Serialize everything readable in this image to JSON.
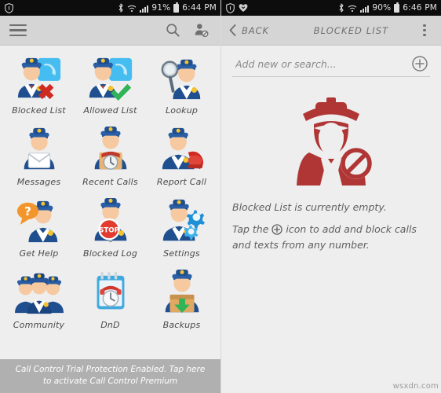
{
  "colors": {
    "statusbar_bg": "#0d0d0d",
    "toolbar_bg": "#d5d5d5",
    "content_bg": "#eeeeee",
    "accent_red": "#b03535",
    "banner_bg": "#b0b0b0",
    "label_text": "#4a4a4a",
    "icon_grey": "#6f6f6f"
  },
  "left": {
    "statusbar": {
      "shield_icon": "shield-icon",
      "bluetooth_icon": "bluetooth-icon",
      "wifi_icon": "wifi-icon",
      "signal_icon": "signal-bars-icon",
      "battery_icon": "battery-icon",
      "battery_percent": "91%",
      "clock": "6:44 PM"
    },
    "toolbar": {
      "menu_icon": "hamburger-menu-icon",
      "search_icon": "search-icon",
      "block_contact_icon": "blocked-contact-icon"
    },
    "grid": [
      {
        "label": "Blocked List",
        "icon": "blocked-list-icon"
      },
      {
        "label": "Allowed List",
        "icon": "allowed-list-icon"
      },
      {
        "label": "Lookup",
        "icon": "lookup-icon"
      },
      {
        "label": "Messages",
        "icon": "messages-icon"
      },
      {
        "label": "Recent Calls",
        "icon": "recent-calls-icon"
      },
      {
        "label": "Report Call",
        "icon": "report-call-icon"
      },
      {
        "label": "Get Help",
        "icon": "get-help-icon"
      },
      {
        "label": "Blocked Log",
        "icon": "blocked-log-icon"
      },
      {
        "label": "Settings",
        "icon": "settings-icon"
      },
      {
        "label": "Community",
        "icon": "community-icon"
      },
      {
        "label": "DnD",
        "icon": "dnd-icon"
      },
      {
        "label": "Backups",
        "icon": "backups-icon"
      }
    ],
    "banner": {
      "line1": "Call Control Trial Protection Enabled. Tap here",
      "line2": "to activate Call Control Premium"
    }
  },
  "right": {
    "statusbar": {
      "shield_icon": "shield-icon",
      "app_icon": "call-control-badge-icon",
      "bluetooth_icon": "bluetooth-icon",
      "wifi_icon": "wifi-icon",
      "signal_icon": "signal-bars-icon",
      "battery_icon": "battery-icon",
      "battery_percent": "90%",
      "clock": "6:46 PM"
    },
    "toolbar": {
      "back_label": "BACK",
      "back_icon": "chevron-left-icon",
      "title": "BLOCKED LIST",
      "overflow_icon": "overflow-menu-icon"
    },
    "search": {
      "placeholder": "Add new or search...",
      "value": "",
      "add_icon": "plus-circle-icon"
    },
    "empty_state": {
      "illustration_icon": "blocked-officer-illustration",
      "line1": "Blocked List is currently empty.",
      "line2_before": "Tap the",
      "line2_icon": "plus-circle-icon",
      "line2_after": "icon to add and block",
      "line3": "calls and texts from any number."
    }
  },
  "watermark": "wsxdn.com"
}
